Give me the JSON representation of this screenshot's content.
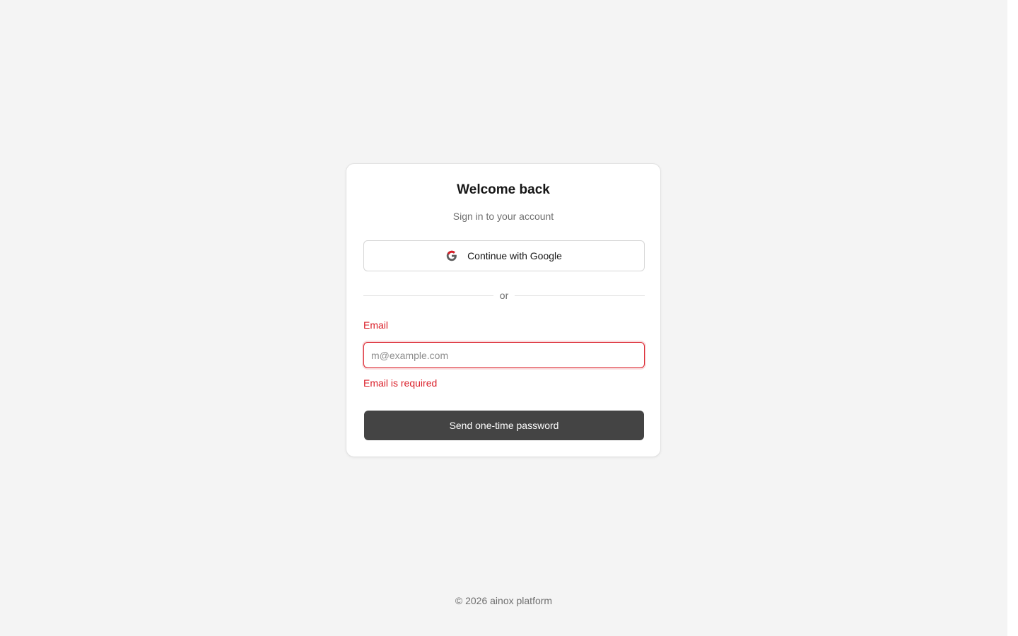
{
  "card": {
    "title": "Welcome back",
    "subtitle": "Sign in to your account"
  },
  "google_button": {
    "icon": "google-icon",
    "label": "Continue with Google"
  },
  "divider": {
    "text": "or"
  },
  "email": {
    "label": "Email",
    "placeholder": "m@example.com",
    "value": "",
    "error": "Email is required"
  },
  "submit": {
    "label": "Send one-time password"
  },
  "footer": {
    "text": "© 2026 ainox platform"
  },
  "colors": {
    "background": "#f4f4f4",
    "card": "#ffffff",
    "error": "#da1e28",
    "primary_button": "#444444",
    "muted_text": "#6f6f6f"
  }
}
